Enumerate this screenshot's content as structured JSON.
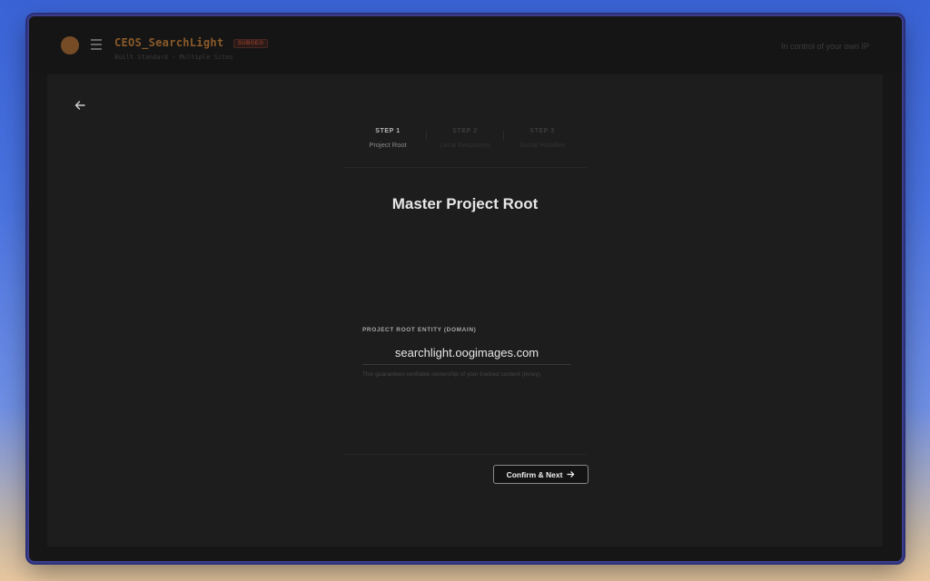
{
  "app": {
    "name": "CEOS_SearchLight",
    "badge": "SUBGEO",
    "subtitle": "Built Standard · Multiple Sites",
    "tagline": "In control of your own IP"
  },
  "steps": [
    {
      "number": "STEP 1",
      "name": "Project Root",
      "active": true
    },
    {
      "number": "STEP 2",
      "name": "Local Resources",
      "active": false
    },
    {
      "number": "STEP 3",
      "name": "Social Handles",
      "active": false
    }
  ],
  "page": {
    "title": "Master Project Root"
  },
  "field": {
    "label": "PROJECT ROOT ENTITY (DOMAIN)",
    "value": "searchlight.oogimages.com",
    "helper": "This guarantees verifiable ownership of your tracked content (rkney)."
  },
  "actions": {
    "confirm_label": "Confirm & Next"
  },
  "icons": {
    "back": "arrow-left-icon",
    "menu": "hamburger-menu-icon",
    "next": "arrow-right-icon"
  }
}
